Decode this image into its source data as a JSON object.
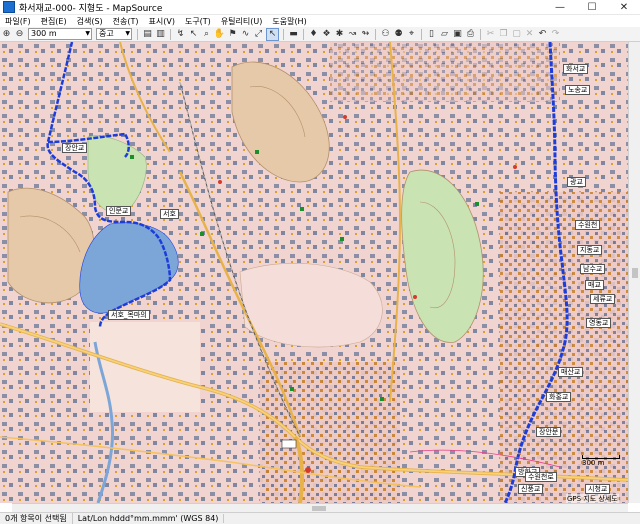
{
  "window": {
    "title": "화서재교-000- 지형도 - MapSource",
    "minimize": "—",
    "maximize": "☐",
    "close": "✕"
  },
  "menu": [
    "파일(F)",
    "편집(E)",
    "검색(S)",
    "전송(T)",
    "표시(V)",
    "도구(T)",
    "유틸리티(U)",
    "도움말(H)"
  ],
  "toolbar": {
    "zoom_value": "300 m",
    "detail_value": "중고"
  },
  "map": {
    "labels": [
      {
        "text": "장안교"
      },
      {
        "text": "인문교"
      },
      {
        "text": "서호"
      },
      {
        "text": "서호_목마의"
      },
      {
        "text": "화서교"
      },
      {
        "text": "노송교"
      },
      {
        "text": "광교"
      },
      {
        "text": "수원천"
      },
      {
        "text": "지동교"
      },
      {
        "text": "남수교"
      },
      {
        "text": "매교"
      },
      {
        "text": "세류교"
      },
      {
        "text": "영동교"
      },
      {
        "text": "매산교"
      },
      {
        "text": "화홍교"
      },
      {
        "text": "장안문"
      },
      {
        "text": "방화교"
      },
      {
        "text": "수원천로"
      },
      {
        "text": "신풍교"
      },
      {
        "text": "시청교"
      }
    ],
    "scale_text": "300 m",
    "gps_text": "GPS 지도 상세도"
  },
  "status": {
    "selection": "0개 항목이 선택됨",
    "coords": "Lat/Lon hddd°mm.mmm' (WGS 84)"
  },
  "colors": {
    "map_bg": "#f1d4cf",
    "track": "#1d3ddb",
    "lake": "#7da6d8",
    "park": "#c9e3b3"
  }
}
